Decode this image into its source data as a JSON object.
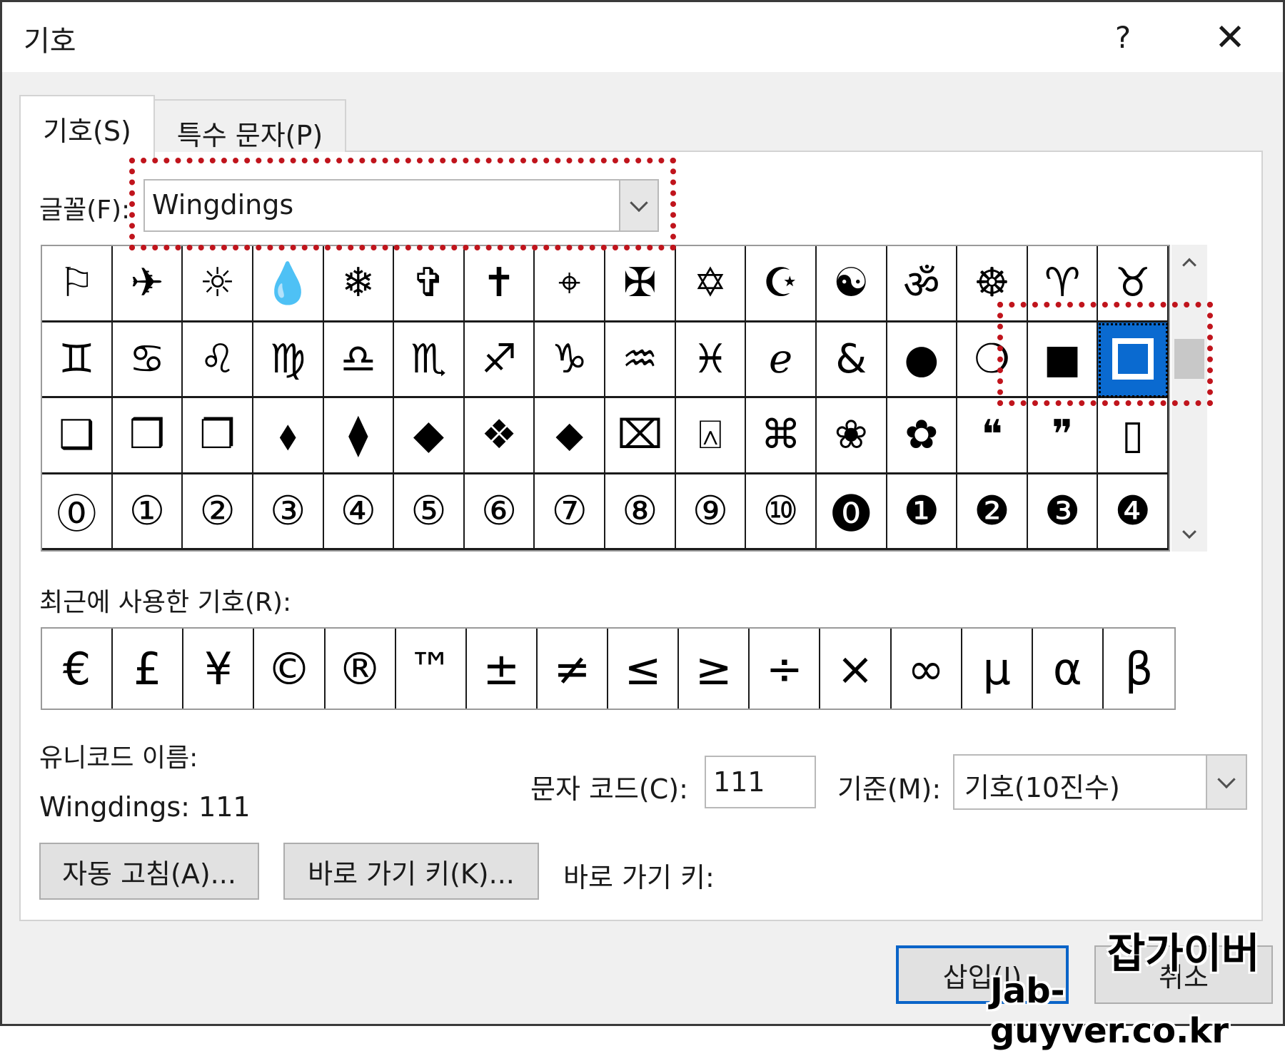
{
  "window": {
    "title": "기호",
    "help_label": "?",
    "close_label": "✕"
  },
  "tabs": [
    {
      "label": "기호(S)",
      "active": true
    },
    {
      "label": "특수 문자(P)",
      "active": false
    }
  ],
  "font": {
    "label": "글꼴(F):",
    "value": "Wingdings"
  },
  "symbol_grid": {
    "rows": [
      [
        "⚐",
        "✈",
        "☼",
        "💧",
        "❄",
        "✞",
        "✝",
        "⌖",
        "✠",
        "✡",
        "☪",
        "☯",
        "ॐ",
        "☸",
        "♈",
        "♉"
      ],
      [
        "♊",
        "♋",
        "♌",
        "♍",
        "♎",
        "♏",
        "♐",
        "♑",
        "♒",
        "♓",
        "ℯ",
        "&",
        "●",
        "❍",
        "■",
        "□"
      ],
      [
        "❑",
        "❒",
        "❐",
        "⬧",
        "⧫",
        "◆",
        "❖",
        "⬥",
        "⌧",
        "⍓",
        "⌘",
        "❀",
        "✿",
        "❝",
        "❞",
        "▯"
      ],
      [
        "⓪",
        "①",
        "②",
        "③",
        "④",
        "⑤",
        "⑥",
        "⑦",
        "⑧",
        "⑨",
        "⑩",
        "⓿",
        "❶",
        "❷",
        "❸",
        "❹"
      ]
    ],
    "selected": {
      "row": 1,
      "col": 15
    }
  },
  "recent": {
    "label": "최근에 사용한 기호(R):",
    "symbols": [
      "€",
      "£",
      "¥",
      "©",
      "®",
      "™",
      "±",
      "≠",
      "≤",
      "≥",
      "÷",
      "×",
      "∞",
      "µ",
      "α",
      "β"
    ]
  },
  "unicode_name": {
    "label": "유니코드 이름:",
    "value": "Wingdings: 111"
  },
  "char_code": {
    "label": "문자 코드(C):",
    "value": "111"
  },
  "basis": {
    "label": "기준(M):",
    "value": "기호(10진수)"
  },
  "buttons": {
    "autocorrect": "자동 고침(A)...",
    "shortcut_key": "바로 가기 키(K)...",
    "shortcut_key_label": "바로 가기 키:",
    "insert": "삽입(I)",
    "cancel": "취소"
  },
  "watermark": {
    "line1": "잡가이버",
    "line2": "Jab-guyver.co.kr"
  },
  "colors": {
    "selection": "#0a6ad0",
    "highlight_border": "#c0141c"
  }
}
